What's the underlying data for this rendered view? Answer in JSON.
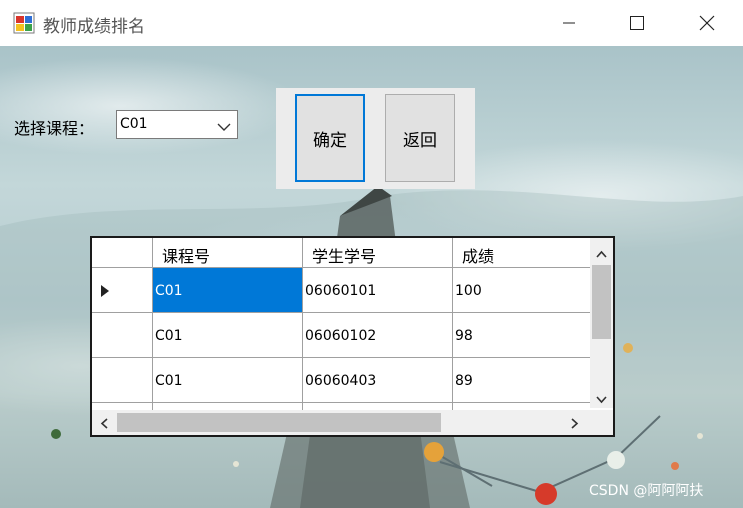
{
  "window": {
    "title": "教师成绩排名"
  },
  "form": {
    "course_label": "选择课程：",
    "course_selected": "C01",
    "ok_label": "确定",
    "back_label": "返回"
  },
  "grid": {
    "columns": [
      "课程号",
      "学生学号",
      "成绩"
    ],
    "rows": [
      [
        "C01",
        "06060101",
        "100"
      ],
      [
        "C01",
        "06060102",
        "98"
      ],
      [
        "C01",
        "06060403",
        "89"
      ]
    ],
    "selected_row": 0,
    "selected_col": 0
  },
  "colors": {
    "accent": "#0078d7",
    "selection": "#0078d7"
  },
  "icons": {
    "app": "app-icon",
    "minimize": "minimize-icon",
    "maximize": "maximize-icon",
    "close": "close-icon",
    "dropdown": "chevron-down-icon",
    "current_row": "row-pointer-icon"
  },
  "watermark": "CSDN @阿阿阿扶"
}
